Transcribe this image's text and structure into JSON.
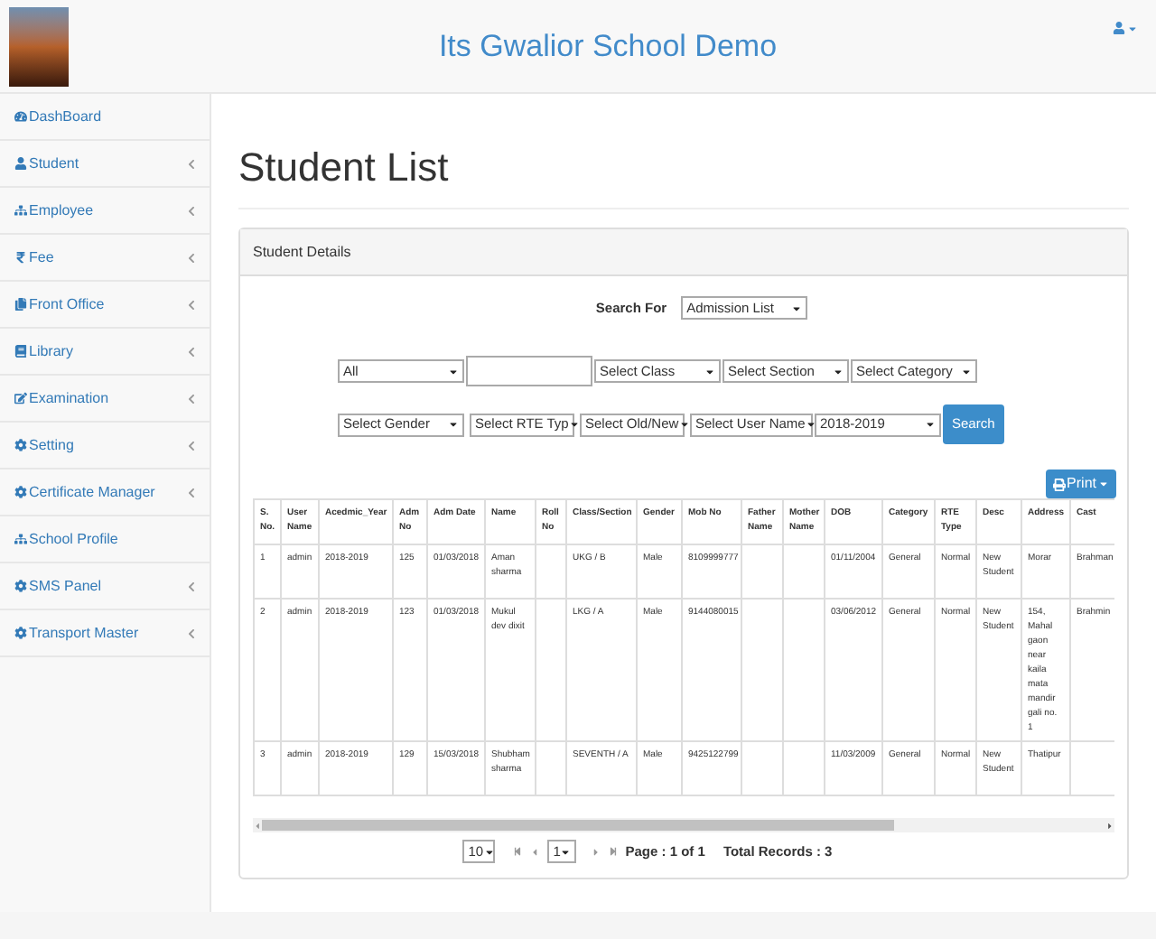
{
  "header": {
    "title": "Its Gwalior School Demo"
  },
  "sidebar": {
    "items": [
      {
        "label": "DashBoard",
        "has_submenu": false
      },
      {
        "label": "Student",
        "has_submenu": true
      },
      {
        "label": "Employee",
        "has_submenu": true
      },
      {
        "label": "Fee",
        "has_submenu": true
      },
      {
        "label": "Front Office",
        "has_submenu": true
      },
      {
        "label": "Library",
        "has_submenu": true
      },
      {
        "label": "Examination",
        "has_submenu": true
      },
      {
        "label": "Setting",
        "has_submenu": true
      },
      {
        "label": "Certificate Manager",
        "has_submenu": true
      },
      {
        "label": "School Profile",
        "has_submenu": false
      },
      {
        "label": "SMS Panel",
        "has_submenu": true
      },
      {
        "label": "Transport Master",
        "has_submenu": true
      }
    ]
  },
  "page_title": "Student List",
  "panel": {
    "title": "Student Details",
    "search_for": {
      "label": "Search For",
      "value": "Admission List"
    },
    "filter_rows": [
      [
        {
          "kind": "select",
          "value": "All"
        },
        {
          "kind": "text"
        },
        {
          "kind": "select",
          "value": "Select Class"
        },
        {
          "kind": "select",
          "value": "Select Section"
        },
        {
          "kind": "select",
          "value": "Select Category"
        }
      ],
      [
        {
          "kind": "select",
          "value": "Select Gender"
        },
        {
          "kind": "select",
          "value": "Select RTE Typ"
        },
        {
          "kind": "select",
          "value": "Select Old/New"
        },
        {
          "kind": "select",
          "value": "Select User Name"
        },
        {
          "kind": "select",
          "value": "2018-2019"
        },
        {
          "kind": "button",
          "value": "Search"
        }
      ]
    ],
    "print_button": "Print",
    "table": {
      "columns": [
        "S. No.",
        "User Name",
        "Acedmic_Year",
        "Adm No",
        "Adm Date",
        "Name",
        "Roll No",
        "Class/Section",
        "Gender",
        "Mob No",
        "Father Name",
        "Mother Name",
        "DOB",
        "Category",
        "RTE Type",
        "Desc",
        "Address",
        "Cast"
      ],
      "rows": [
        [
          "1",
          "admin",
          "2018-2019",
          "125",
          "01/03/2018",
          "Aman sharma",
          null,
          "UKG / B",
          "Male",
          "8109999777",
          null,
          null,
          "01/11/2004",
          "General",
          "Normal",
          "New Student",
          "Morar",
          "Brahman"
        ],
        [
          "2",
          "admin",
          "2018-2019",
          "123",
          "01/03/2018",
          "Mukul dev dixit",
          null,
          "LKG / A",
          "Male",
          "9144080015",
          null,
          null,
          "03/06/2012",
          "General",
          "Normal",
          "New Student",
          "154, Mahal gaon near kaila mata mandir gali no. 1",
          "Brahmin"
        ],
        [
          "3",
          "admin",
          "2018-2019",
          "129",
          "15/03/2018",
          "Shubham sharma",
          null,
          "SEVENTH / A",
          "Male",
          "9425122799",
          null,
          null,
          "11/03/2009",
          "General",
          "Normal",
          "New Student",
          "Thatipur",
          null
        ]
      ]
    },
    "pagination": {
      "page_size": "10",
      "page": "1",
      "page_info": "Page : 1 of 1",
      "total": "Total Records : 3"
    }
  }
}
